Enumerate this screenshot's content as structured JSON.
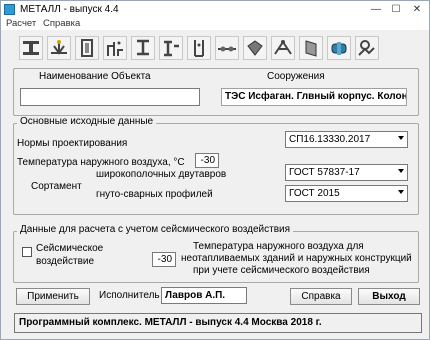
{
  "window": {
    "title": "МЕТАЛЛ - выпуск 4.4",
    "minimize": "—",
    "maximize": "☐",
    "close": "✕"
  },
  "menu": {
    "items": [
      "Расчет",
      "Справка"
    ]
  },
  "toolbar": {
    "icons": [
      "i-beam-icon",
      "weld-joint-icon",
      "column-section-icon",
      "stair-frame-icon",
      "column-base-icon",
      "beam-column-icon",
      "frame-column-icon",
      "bolt-joint-icon",
      "sheet-metal-icon",
      "truss-node-icon",
      "wall-panel-icon",
      "pipe-coupling-icon",
      "structure-model-icon"
    ]
  },
  "object": {
    "name_label": "Наименование Объекта",
    "name_value": "",
    "structure_label": "Сооружения",
    "structure_value": "ТЭС Исфаган. Глвный корпус. Колонна"
  },
  "base_data": {
    "legend": "Основные исходные данные",
    "norms_label": "Нормы проектирования",
    "norms_value": "СП16.13330.2017",
    "temp_label": "Температура наружного воздуха, °С",
    "temp_value": "-30",
    "assortment_label": "Сортамент",
    "wide_flange_label": "широкополочных двутавров",
    "wide_flange_value": "ГОСТ 57837-17",
    "bent_welded_label": "гнуто-сварных профилей",
    "bent_welded_value": "ГОСТ 2015"
  },
  "seismic": {
    "legend": "Данные для расчета с учетом сейсмического воздействия",
    "checkbox_label_line1": "Сейсмическое",
    "checkbox_label_line2": "воздействие",
    "temp_value": "-30",
    "desc_line1": "Температура наружного воздуха для",
    "desc_line2": "неотапливаемых зданий и наружных конструкций",
    "desc_line3": "при учете сейсмического воздействия"
  },
  "footer": {
    "apply_label": "Применить",
    "executor_label": "Исполнитель",
    "executor_value": "Лавров А.П.",
    "help_label": "Справка",
    "exit_label": "Выход"
  },
  "status": {
    "text": "Программный комплекс.  МЕТАЛЛ - выпуск 4.4  Москва 2018 г."
  }
}
